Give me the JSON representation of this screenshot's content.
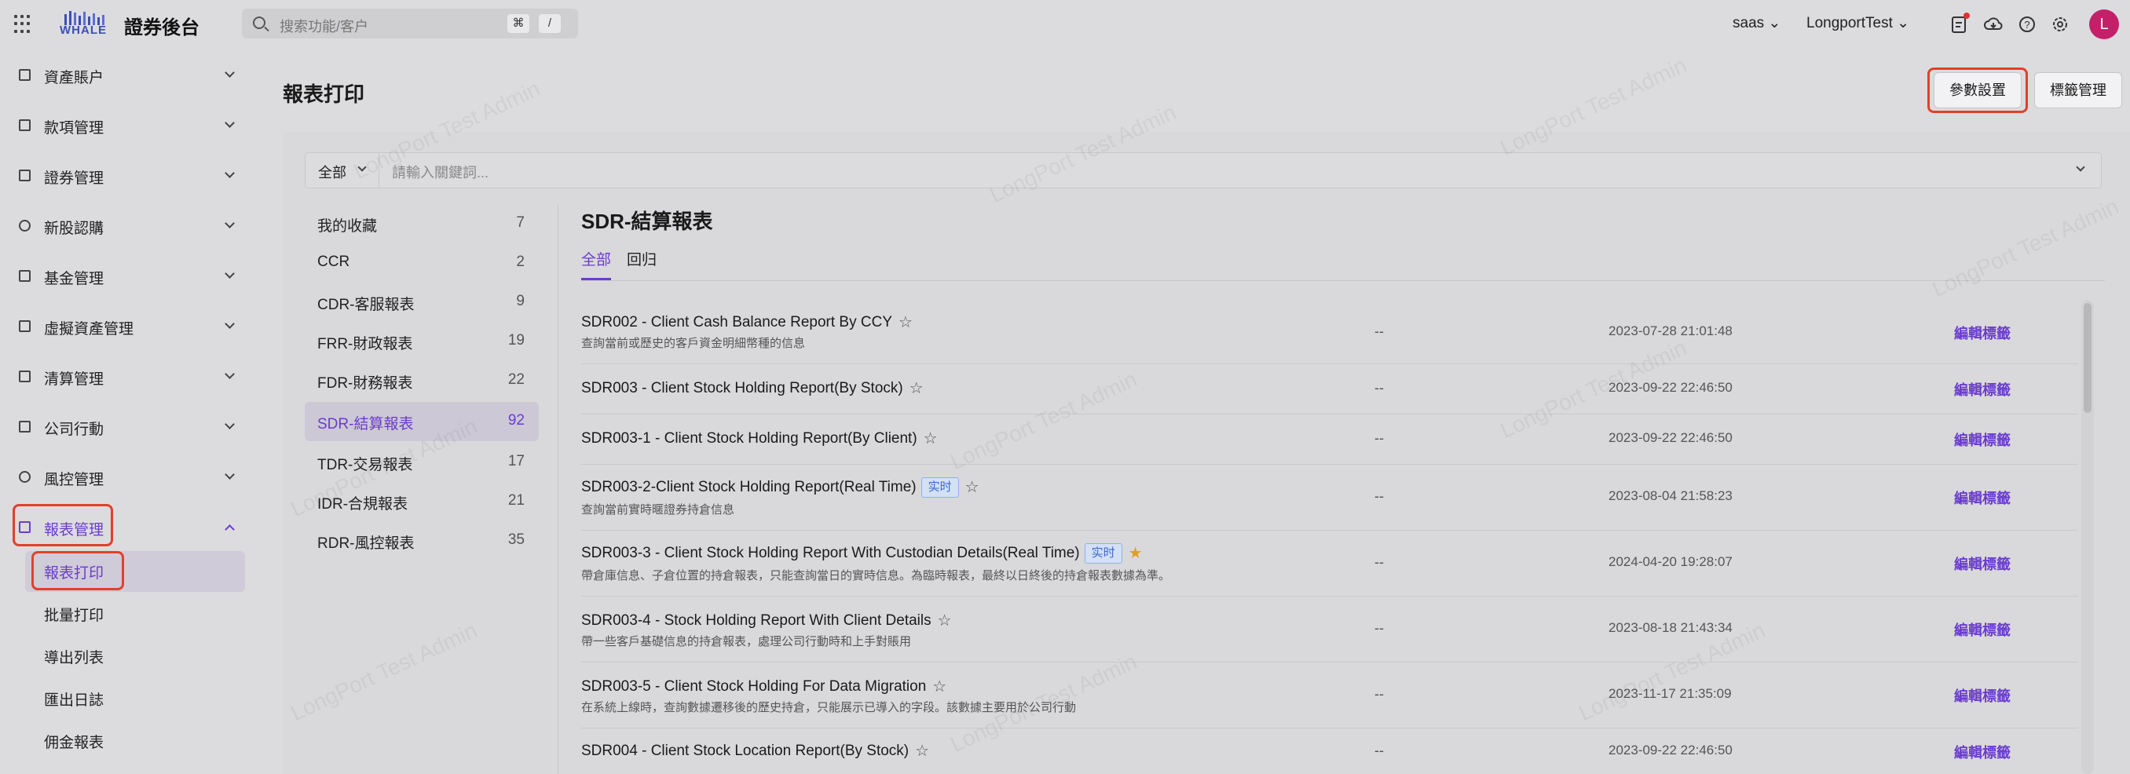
{
  "header": {
    "logo_text": "WHALE",
    "app_title": "證券後台",
    "search_placeholder": "搜索功能/客户",
    "shortcut_cmd": "⌘",
    "shortcut_slash": "/",
    "tenant": "saas",
    "account": "LongportTest",
    "avatar_letter": "L",
    "icons": [
      "apps-grid-icon",
      "search-icon",
      "task-icon",
      "download-icon",
      "help-icon",
      "settings-icon"
    ]
  },
  "sidebar": {
    "items": [
      {
        "label": "資產賬户"
      },
      {
        "label": "款項管理"
      },
      {
        "label": "證券管理"
      },
      {
        "label": "新股認購"
      },
      {
        "label": "基金管理"
      },
      {
        "label": "虛擬資產管理"
      },
      {
        "label": "清算管理"
      },
      {
        "label": "公司行動"
      },
      {
        "label": "風控管理"
      },
      {
        "label": "報表管理"
      }
    ],
    "sub_items": [
      {
        "label": "報表打印"
      },
      {
        "label": "批量打印"
      },
      {
        "label": "導出列表"
      },
      {
        "label": "匯出日誌"
      },
      {
        "label": "佣金報表"
      }
    ]
  },
  "page": {
    "title": "報表打印",
    "btn_params": "參數設置",
    "btn_tags": "標籤管理"
  },
  "filter": {
    "select_value": "全部",
    "placeholder": "請輸入關鍵詞..."
  },
  "categories": [
    {
      "label": "我的收藏",
      "count": "7"
    },
    {
      "label": "CCR",
      "count": "2"
    },
    {
      "label": "CDR-客服報表",
      "count": "9"
    },
    {
      "label": "FRR-財政報表",
      "count": "19"
    },
    {
      "label": "FDR-財務報表",
      "count": "22"
    },
    {
      "label": "SDR-結算報表",
      "count": "92"
    },
    {
      "label": "TDR-交易報表",
      "count": "17"
    },
    {
      "label": "IDR-合規報表",
      "count": "21"
    },
    {
      "label": "RDR-風控報表",
      "count": "35"
    }
  ],
  "section": {
    "title": "SDR-結算報表",
    "tabs": [
      "全部",
      "回归"
    ]
  },
  "reports": [
    {
      "title": "SDR002 - Client Cash Balance Report By CCY",
      "tag": "",
      "starred": false,
      "desc": "查詢當前或歷史的客戶資金明細幣種的信息",
      "dash": "--",
      "date": "2023-07-28 21:01:48",
      "edit": "編輯標籤"
    },
    {
      "title": "SDR003 - Client Stock Holding Report(By Stock)",
      "tag": "",
      "starred": false,
      "desc": "",
      "dash": "--",
      "date": "2023-09-22 22:46:50",
      "edit": "編輯標籤"
    },
    {
      "title": "SDR003-1 - Client Stock Holding Report(By Client)",
      "tag": "",
      "starred": false,
      "desc": "",
      "dash": "--",
      "date": "2023-09-22 22:46:50",
      "edit": "編輯標籤"
    },
    {
      "title": "SDR003-2-Client Stock Holding Report(Real Time)",
      "tag": "实时",
      "starred": false,
      "desc": "查詢當前實時暱證券持倉信息",
      "dash": "--",
      "date": "2023-08-04 21:58:23",
      "edit": "編輯標籤"
    },
    {
      "title": "SDR003-3 - Client Stock Holding Report With Custodian Details(Real Time)",
      "tag": "实时",
      "starred": true,
      "desc": "帶倉庫信息、子倉位置的持倉報表，只能查詢當日的實時信息。為臨時報表，最終以日終後的持倉報表數據為準。",
      "dash": "--",
      "date": "2024-04-20 19:28:07",
      "edit": "編輯標籤"
    },
    {
      "title": "SDR003-4 - Stock Holding Report With Client Details",
      "tag": "",
      "starred": false,
      "desc": "帶一些客戶基礎信息的持倉報表，處理公司行動時和上手對賬用",
      "dash": "--",
      "date": "2023-08-18 21:43:34",
      "edit": "編輯標籤"
    },
    {
      "title": "SDR003-5 - Client Stock Holding For Data Migration",
      "tag": "",
      "starred": false,
      "desc": "在系統上線時，查詢數據遷移後的歷史持倉，只能展示已導入的字段。該數據主要用於公司行動",
      "dash": "--",
      "date": "2023-11-17 21:35:09",
      "edit": "編輯標籤"
    },
    {
      "title": "SDR004 - Client Stock Location Report(By Stock)",
      "tag": "",
      "starred": false,
      "desc": "",
      "dash": "--",
      "date": "2023-09-22 22:46:50",
      "edit": "編輯標籤"
    }
  ],
  "watermark_text": "LongPort Test Admin",
  "colors": {
    "accent": "#6a3ccd",
    "highlight": "#e2402b",
    "star": "#e0a020"
  }
}
